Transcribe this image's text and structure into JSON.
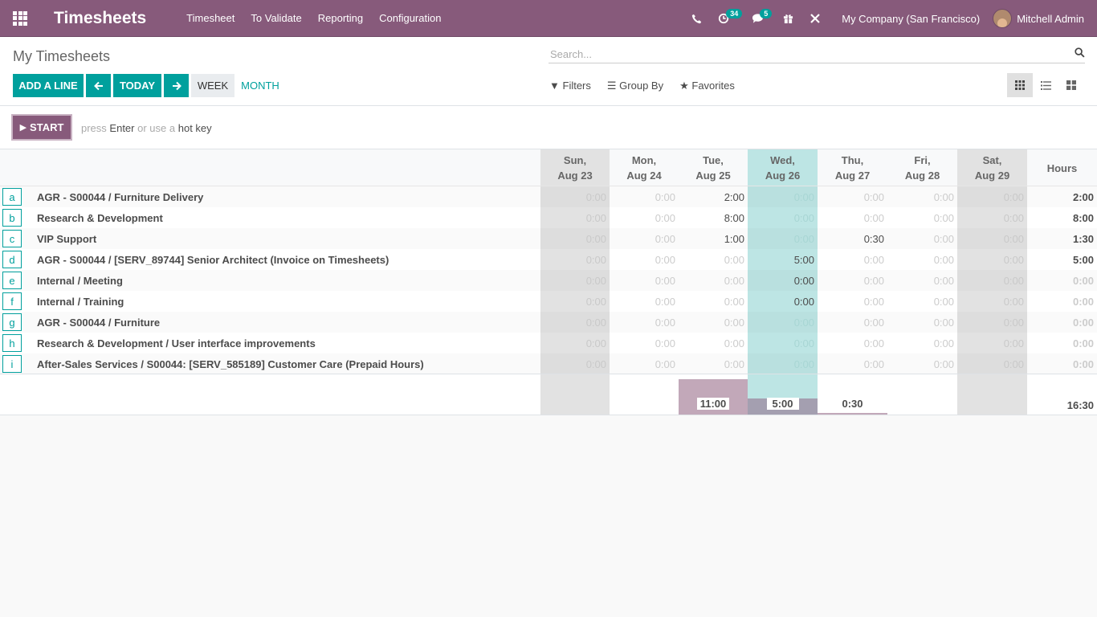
{
  "nav": {
    "brand": "Timesheets",
    "menu": [
      "Timesheet",
      "To Validate",
      "Reporting",
      "Configuration"
    ],
    "activity_badge": "34",
    "messages_badge": "5",
    "company": "My Company (San Francisco)",
    "user": "Mitchell Admin"
  },
  "control": {
    "title": "My Timesheets",
    "search_placeholder": "Search...",
    "add_line": "ADD A LINE",
    "today": "TODAY",
    "week": "WEEK",
    "month": "MONTH",
    "filters": "Filters",
    "group_by": "Group By",
    "favorites": "Favorites"
  },
  "timer": {
    "start": "START",
    "hint_press": "press",
    "hint_enter": "Enter",
    "hint_or": "or use a",
    "hint_hotkey": "hot key"
  },
  "grid": {
    "days": [
      {
        "day": "Sun,",
        "date": "Aug 23"
      },
      {
        "day": "Mon,",
        "date": "Aug 24"
      },
      {
        "day": "Tue,",
        "date": "Aug 25"
      },
      {
        "day": "Wed,",
        "date": "Aug 26"
      },
      {
        "day": "Thu,",
        "date": "Aug 27"
      },
      {
        "day": "Fri,",
        "date": "Aug 28"
      },
      {
        "day": "Sat,",
        "date": "Aug 29"
      }
    ],
    "hours_header": "Hours",
    "rows": [
      {
        "key": "a",
        "name": "AGR - S00044  /  Furniture Delivery",
        "cells": [
          "0:00",
          "0:00",
          "2:00",
          "0:00",
          "0:00",
          "0:00",
          "0:00"
        ],
        "total": "2:00"
      },
      {
        "key": "b",
        "name": "Research & Development",
        "cells": [
          "0:00",
          "0:00",
          "8:00",
          "0:00",
          "0:00",
          "0:00",
          "0:00"
        ],
        "total": "8:00"
      },
      {
        "key": "c",
        "name": "VIP Support",
        "cells": [
          "0:00",
          "0:00",
          "1:00",
          "0:00",
          "0:30",
          "0:00",
          "0:00"
        ],
        "total": "1:30"
      },
      {
        "key": "d",
        "name": "AGR - S00044  /  [SERV_89744] Senior Architect (Invoice on Timesheets)",
        "cells": [
          "0:00",
          "0:00",
          "0:00",
          "5:00",
          "0:00",
          "0:00",
          "0:00"
        ],
        "total": "5:00"
      },
      {
        "key": "e",
        "name": "Internal  /  Meeting",
        "cells": [
          "0:00",
          "0:00",
          "0:00",
          "0:00",
          "0:00",
          "0:00",
          "0:00"
        ],
        "total": "0:00"
      },
      {
        "key": "f",
        "name": "Internal  /  Training",
        "cells": [
          "0:00",
          "0:00",
          "0:00",
          "0:00",
          "0:00",
          "0:00",
          "0:00"
        ],
        "total": "0:00"
      },
      {
        "key": "g",
        "name": "AGR - S00044  /  Furniture",
        "cells": [
          "0:00",
          "0:00",
          "0:00",
          "0:00",
          "0:00",
          "0:00",
          "0:00"
        ],
        "total": "0:00"
      },
      {
        "key": "h",
        "name": "Research & Development  /  User interface improvements",
        "cells": [
          "0:00",
          "0:00",
          "0:00",
          "0:00",
          "0:00",
          "0:00",
          "0:00"
        ],
        "total": "0:00"
      },
      {
        "key": "i",
        "name": "After-Sales Services /  S00044: [SERV_585189] Customer Care (Prepaid Hours)",
        "cells": [
          "0:00",
          "0:00",
          "0:00",
          "0:00",
          "0:00",
          "0:00",
          "0:00"
        ],
        "total": "0:00"
      }
    ],
    "unhighlighted_cells": [
      [
        0,
        3
      ],
      [
        1,
        3
      ],
      [
        2,
        3
      ],
      [
        6,
        3
      ],
      [
        7,
        3
      ],
      [
        8,
        3
      ]
    ],
    "day_totals": [
      "",
      "",
      "11:00",
      "5:00",
      "0:30",
      "",
      ""
    ],
    "day_hours": [
      0,
      0,
      11,
      5,
      0.5,
      0,
      0
    ],
    "grand_total": "16:30"
  },
  "colors": {
    "brand": "#875a7b",
    "primary": "#00a09d",
    "today_column": "#bde5e4",
    "weekend_column": "#e2e2e2"
  }
}
